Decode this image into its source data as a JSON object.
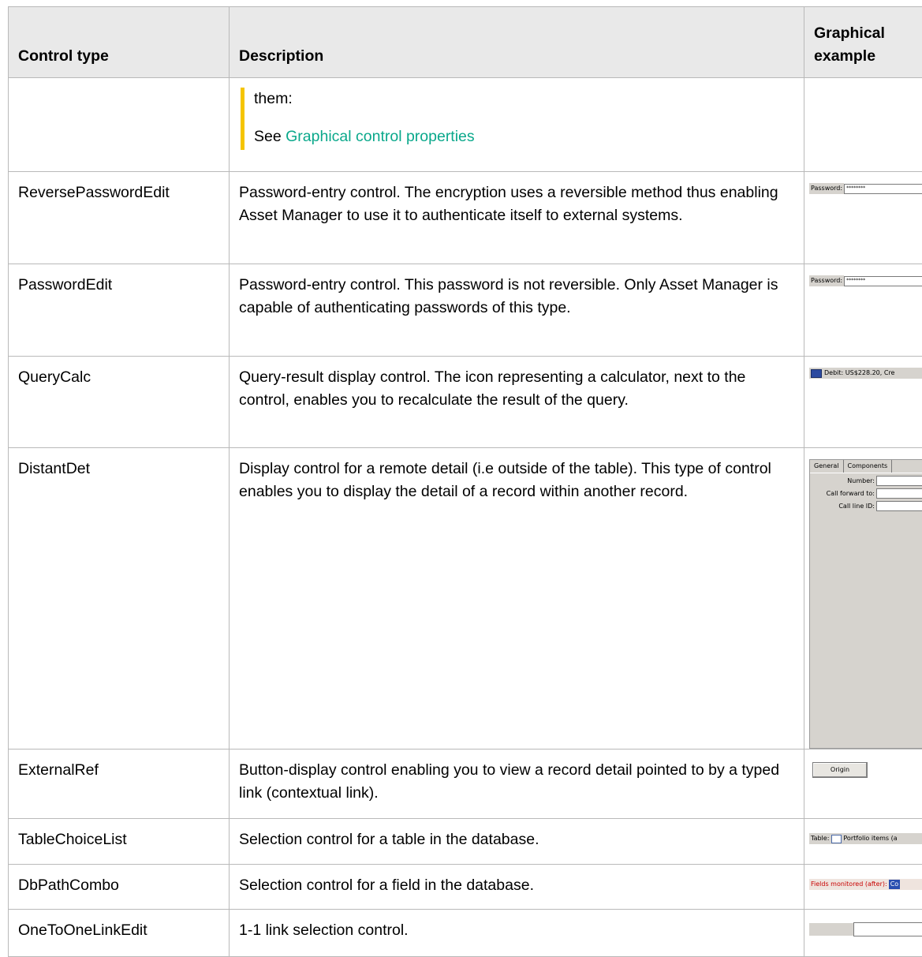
{
  "header": {
    "control_type": "Control type",
    "description": "Description",
    "graphical_example": "Graphical example"
  },
  "continued_row": {
    "note_line1": "them:",
    "note_see": "See ",
    "note_link": "Graphical control properties"
  },
  "rows": [
    {
      "type": "ReversePasswordEdit",
      "description": "Password-entry control. The encryption uses a reversible method thus enabling Asset Manager to use it to authenticate itself to external systems.",
      "example": {
        "label": "Password:",
        "value": "********"
      }
    },
    {
      "type": "PasswordEdit",
      "description": "Password-entry control. This password is not reversible. Only Asset Manager is capable of authenticating passwords of this type.",
      "example": {
        "label": "Password:",
        "value": "********"
      }
    },
    {
      "type": "QueryCalc",
      "description": "Query-result display control. The icon representing a calculator, next to the control, enables you to recalculate the result of the query.",
      "example": {
        "text": "Debit: US$228.20, Cre"
      }
    },
    {
      "type": "DistantDet",
      "description": "Display control for a remote detail (i.e outside of the table). This type of control enables you to display the detail of a record within another record.",
      "example": {
        "tab1": "General",
        "tab2": "Components",
        "field1": "Number:",
        "field2": "Call forward to:",
        "field3": "Call line ID:"
      }
    },
    {
      "type": "ExternalRef",
      "description": "Button-display control enabling you to view a record detail pointed to by a typed link (contextual link).",
      "example": {
        "button": "Origin"
      }
    },
    {
      "type": "TableChoiceList",
      "description": "Selection control for a table in the database.",
      "example": {
        "label": "Table:",
        "value": "Portfolio items (a"
      }
    },
    {
      "type": "DbPathCombo",
      "description": "Selection control for a field in the database.",
      "example": {
        "label": "Fields monitored (after):",
        "value": "Co"
      }
    },
    {
      "type": "OneToOneLinkEdit",
      "description": "1-1 link selection control."
    }
  ]
}
